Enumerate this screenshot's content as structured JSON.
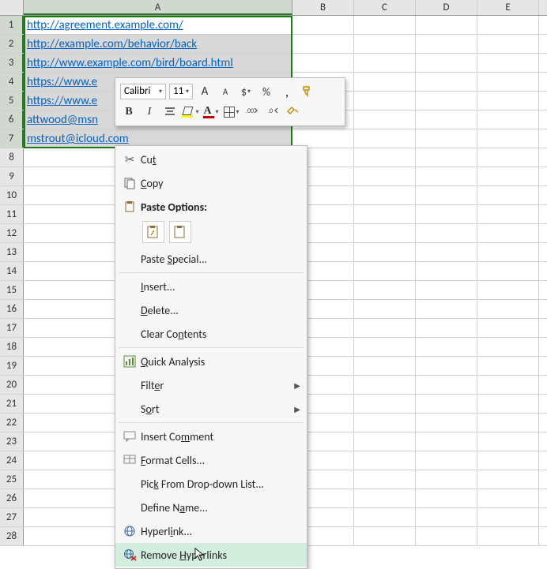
{
  "columns": [
    "A",
    "B",
    "C",
    "D",
    "E"
  ],
  "row_count": 28,
  "selected_rows": [
    1,
    2,
    3,
    4,
    5,
    6,
    7
  ],
  "cells_A": [
    "http://agreement.example.com/",
    "http://example.com/behavior/back",
    "http://www.example.com/bird/board.html",
    "https://www.e",
    "https://www.e",
    "attwood@msn",
    "mstrout@icloud.com"
  ],
  "mini_toolbar": {
    "font_name": "Calibri",
    "font_size": "11",
    "grow_label": "A",
    "shrink_label": "A",
    "currency_label": "$",
    "percent_label": "%",
    "comma_label": ",",
    "bold_label": "B",
    "italic_label": "I",
    "fontcolor_label": "A"
  },
  "context_menu": {
    "cut": "Cut",
    "copy": "Copy",
    "paste_options": "Paste Options:",
    "paste_special": "Paste Special...",
    "insert": "Insert...",
    "delete": "Delete...",
    "clear_contents": "Clear Contents",
    "quick_analysis": "Quick Analysis",
    "filter": "Filter",
    "sort": "Sort",
    "insert_comment": "Insert Comment",
    "format_cells": "Format Cells...",
    "pick_list": "Pick From Drop-down List...",
    "define_name": "Define Name...",
    "hyperlink": "Hyperlink...",
    "remove_hyperlinks": "Remove Hyperlinks",
    "underline_keys": {
      "cut": "t",
      "copy": "C",
      "paste_special": "S",
      "insert": "I",
      "delete": "D",
      "clear_contents": "N",
      "quick_analysis": "Q",
      "filter": "E",
      "sort": "O",
      "insert_comment": "m",
      "format_cells": "F",
      "pick_list": "K",
      "define_name": "A",
      "hyperlink": "i",
      "remove_hyperlinks": "H"
    }
  }
}
